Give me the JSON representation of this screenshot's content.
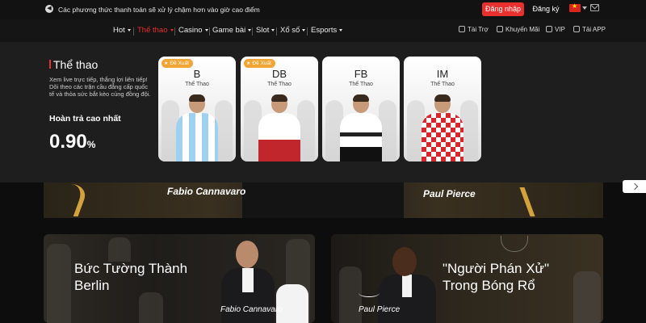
{
  "topbar": {
    "announcement": "Các phương thức thanh toán sẽ xử lý chậm hơn vào giờ cao điểm",
    "login_label": "Đăng nhập",
    "register_label": "Đăng ký"
  },
  "nav": {
    "items": [
      {
        "label": "Hot",
        "active": false
      },
      {
        "label": "Thể thao",
        "active": true
      },
      {
        "label": "Casino",
        "active": false
      },
      {
        "label": "Game bài",
        "active": false
      },
      {
        "label": "Slot",
        "active": false
      },
      {
        "label": "Xổ số",
        "active": false
      },
      {
        "label": "Esports",
        "active": false
      }
    ],
    "utilities": [
      {
        "label": "Tài Trợ",
        "icon": "sponsor-icon"
      },
      {
        "label": "Khuyến Mãi",
        "icon": "promo-icon"
      },
      {
        "label": "VIP",
        "icon": "vip-icon"
      },
      {
        "label": "Tải APP",
        "icon": "app-icon"
      }
    ]
  },
  "panel": {
    "title": "Thể thao",
    "description": "Xem live trực tiếp, thắng lợi liên tiếp! Dõi theo các trận cầu đẳng cấp quốc tế và thỏa sức bắt kèo cùng đồng đội.",
    "rebate_label": "Hoàn trả cao nhất",
    "rebate_value": "0.90",
    "rebate_unit": "%",
    "cards": [
      {
        "code": "B",
        "subtitle": "Thể Thao",
        "badge": "Đề Xuất"
      },
      {
        "code": "DB",
        "subtitle": "Thể Thao",
        "badge": "Đề Xuất"
      },
      {
        "code": "FB",
        "subtitle": "Thể Thao",
        "badge": ""
      },
      {
        "code": "IM",
        "subtitle": "Thể Thao",
        "badge": ""
      }
    ]
  },
  "band": {
    "left_name": "Fabio Cannavaro",
    "right_name": "Paul Pierce"
  },
  "banners": {
    "left": {
      "title_line1": "Bức Tường Thành",
      "title_line2": "Berlin",
      "caption": "Fabio Cannavaro"
    },
    "right": {
      "title_line1": "\"Người Phán Xử\"",
      "title_line2": "Trong Bóng Rổ",
      "caption": "Paul Pierce"
    }
  },
  "colors": {
    "accent": "#e8302f",
    "badge": "#f0a534",
    "gold": "#d4a23c"
  }
}
